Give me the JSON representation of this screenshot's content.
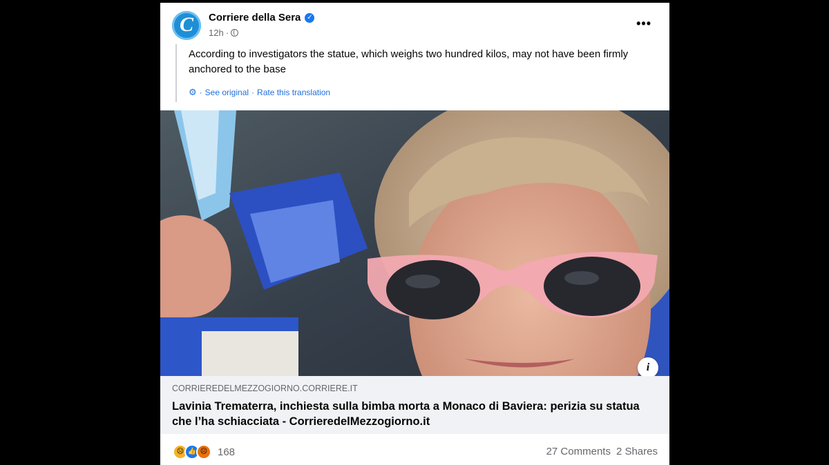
{
  "post": {
    "page_name": "Corriere della Sera",
    "avatar_letter": "C",
    "time": "12h",
    "time_separator": "·",
    "more_label": "•••",
    "translated_text": "According to investigators the statue, which weighs two hundred kilos, may not have been firmly anchored to the base",
    "see_original": "See original",
    "separator": "·",
    "rate_translation": "Rate this translation"
  },
  "link_preview": {
    "domain": "CORRIEREDELMEZZOGIORNO.CORRIERE.IT",
    "headline": "Lavinia Trematerra, inchiesta sulla bimba morta a Monaco di Baviera: perizia su statua che l’ha schiacciata - CorrieredelMezzogiorno.it",
    "info_label": "i"
  },
  "footer": {
    "reaction_count": "168",
    "comments": "27 Comments",
    "shares": "2 Shares"
  },
  "icons": [
    "verified-badge-icon",
    "globe-icon",
    "more-icon",
    "gear-icon",
    "info-icon",
    "sad-reaction-icon",
    "like-reaction-icon",
    "angry-reaction-icon"
  ],
  "colors": {
    "background": "#000000",
    "card": "#ffffff",
    "link_box": "#f0f2f5",
    "accent_blue": "#1877f2",
    "muted": "#65676b"
  }
}
